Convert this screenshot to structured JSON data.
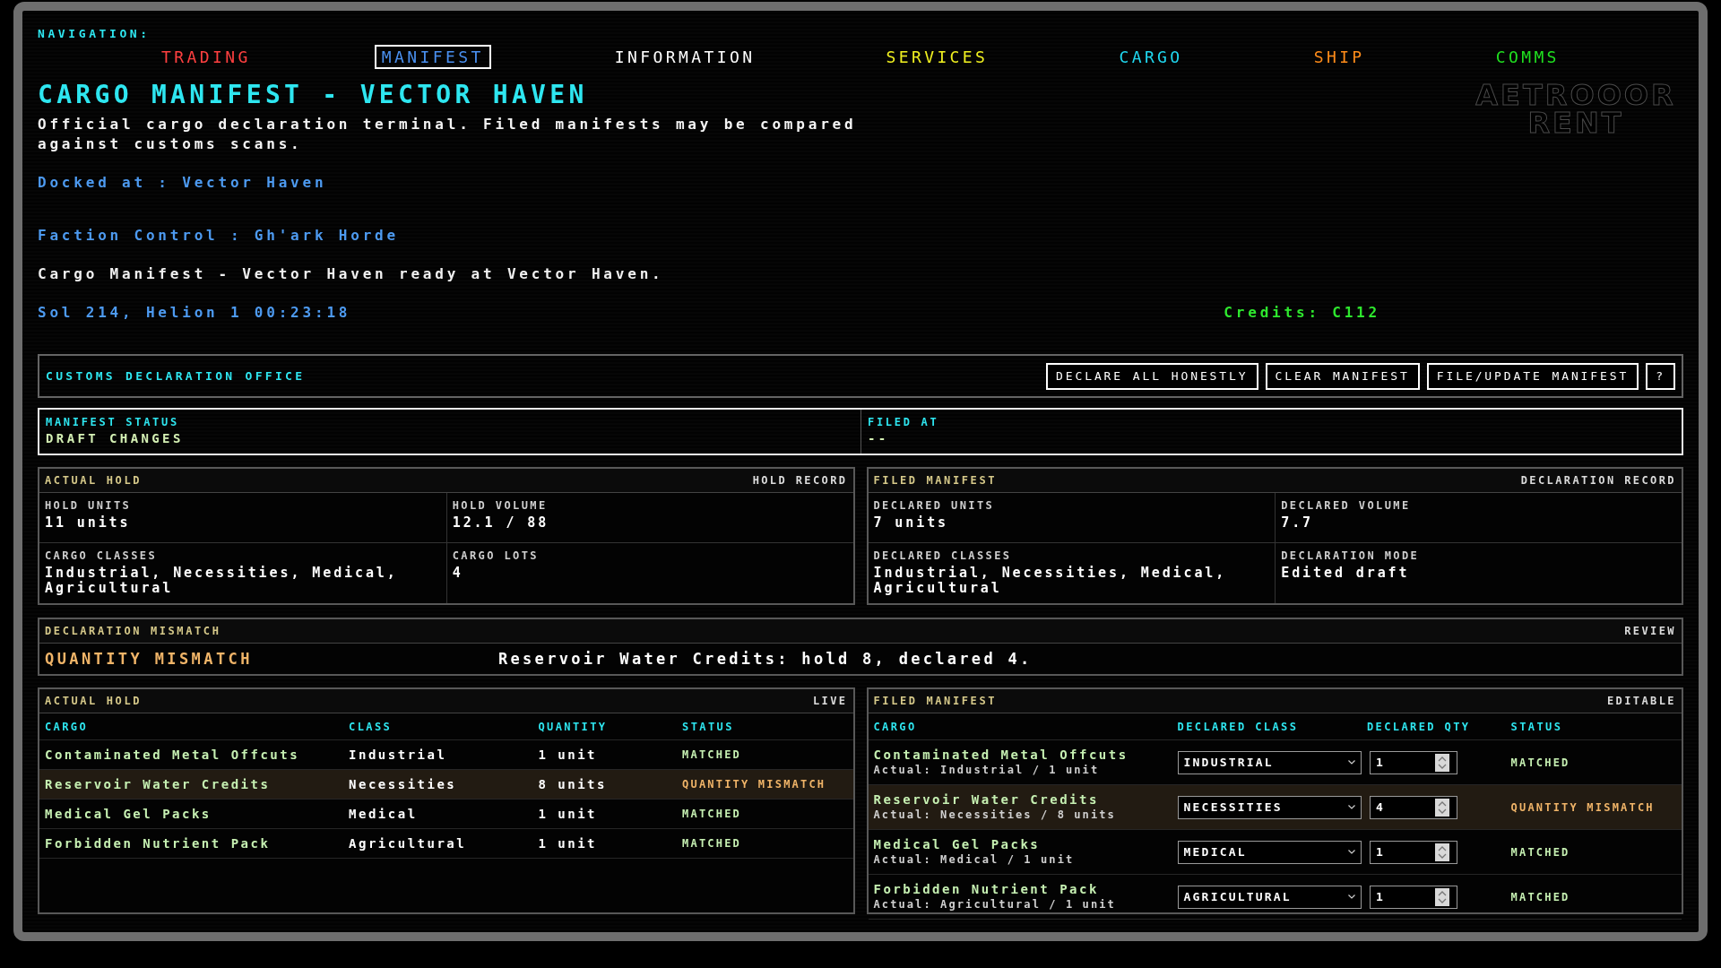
{
  "navigation": {
    "label": "NAVIGATION:",
    "items": [
      {
        "label": "TRADING",
        "color": "#ff4040",
        "selected": false
      },
      {
        "label": "MANIFEST",
        "color": "#4a90f0",
        "selected": true
      },
      {
        "label": "INFORMATION",
        "color": "#ffffff",
        "selected": false
      },
      {
        "label": "SERVICES",
        "color": "#f0f020",
        "selected": false
      },
      {
        "label": "CARGO",
        "color": "#20d8f0",
        "selected": false
      },
      {
        "label": "SHIP",
        "color": "#ff8c1a",
        "selected": false
      },
      {
        "label": "COMMS",
        "color": "#20e020",
        "selected": false
      }
    ]
  },
  "header": {
    "title": "CARGO MANIFEST - VECTOR HAVEN",
    "description": "Official cargo declaration terminal. Filed manifests may be compared against customs scans.",
    "docked_at": "Docked at : Vector Haven",
    "faction_control": "Faction Control : Gh'ark Horde",
    "status_message": "Cargo Manifest - Vector Haven ready at Vector Haven.",
    "date": "Sol 214, Helion 1 00:23:18",
    "credits": "Credits: C112",
    "logo": [
      "AETROOOR",
      "RENT"
    ]
  },
  "customs_office": {
    "title": "CUSTOMS DECLARATION OFFICE",
    "buttons": [
      "DECLARE ALL HONESTLY",
      "CLEAR MANIFEST",
      "FILE/UPDATE MANIFEST",
      "?"
    ]
  },
  "manifest_status": [
    {
      "label": "MANIFEST STATUS",
      "value": "DRAFT CHANGES"
    },
    {
      "label": "FILED AT",
      "value": "--"
    }
  ],
  "records": [
    {
      "title": "ACTUAL HOLD",
      "tag": "HOLD RECORD",
      "fields": [
        {
          "label": "HOLD UNITS",
          "value": "11 units"
        },
        {
          "label": "HOLD VOLUME",
          "value": "12.1 / 88"
        },
        {
          "label": "CARGO CLASSES",
          "value": "Industrial, Necessities, Medical, Agricultural"
        },
        {
          "label": "CARGO LOTS",
          "value": "4"
        }
      ]
    },
    {
      "title": "FILED MANIFEST",
      "tag": "DECLARATION RECORD",
      "fields": [
        {
          "label": "DECLARED UNITS",
          "value": "7 units"
        },
        {
          "label": "DECLARED VOLUME",
          "value": "7.7"
        },
        {
          "label": "DECLARED CLASSES",
          "value": "Industrial, Necessities, Medical, Agricultural"
        },
        {
          "label": "DECLARATION MODE",
          "value": "Edited draft"
        }
      ]
    }
  ],
  "declaration_mismatch": {
    "title": "DECLARATION MISMATCH",
    "tag": "REVIEW",
    "type": "QUANTITY MISMATCH",
    "message": "Reservoir Water Credits: hold 8, declared 4."
  },
  "actual_hold": {
    "title": "ACTUAL HOLD",
    "tag": "LIVE",
    "columns": [
      "CARGO",
      "CLASS",
      "QUANTITY",
      "STATUS"
    ],
    "rows": [
      {
        "cargo": "Contaminated Metal Offcuts",
        "class": "Industrial",
        "quantity": "1 unit",
        "status": "MATCHED",
        "flagged": false
      },
      {
        "cargo": "Reservoir Water Credits",
        "class": "Necessities",
        "quantity": "8 units",
        "status": "QUANTITY MISMATCH",
        "flagged": true
      },
      {
        "cargo": "Medical Gel Packs",
        "class": "Medical",
        "quantity": "1 unit",
        "status": "MATCHED",
        "flagged": false
      },
      {
        "cargo": "Forbidden Nutrient Pack",
        "class": "Agricultural",
        "quantity": "1 unit",
        "status": "MATCHED",
        "flagged": false
      }
    ]
  },
  "filed_manifest": {
    "title": "FILED MANIFEST",
    "tag": "EDITABLE",
    "columns": [
      "CARGO",
      "DECLARED CLASS",
      "DECLARED QTY",
      "STATUS"
    ],
    "rows": [
      {
        "cargo": "Contaminated Metal Offcuts",
        "actual": "Actual: Industrial / 1 unit",
        "declared_class": "INDUSTRIAL",
        "declared_qty": "1",
        "status": "MATCHED",
        "flagged": false
      },
      {
        "cargo": "Reservoir Water Credits",
        "actual": "Actual: Necessities / 8 units",
        "declared_class": "NECESSITIES",
        "declared_qty": "4",
        "status": "QUANTITY MISMATCH",
        "flagged": true
      },
      {
        "cargo": "Medical Gel Packs",
        "actual": "Actual: Medical / 1 unit",
        "declared_class": "MEDICAL",
        "declared_qty": "1",
        "status": "MATCHED",
        "flagged": false
      },
      {
        "cargo": "Forbidden Nutrient Pack",
        "actual": "Actual: Agricultural / 1 unit",
        "declared_class": "AGRICULTURAL",
        "declared_qty": "1",
        "status": "MATCHED",
        "flagged": false
      }
    ]
  }
}
